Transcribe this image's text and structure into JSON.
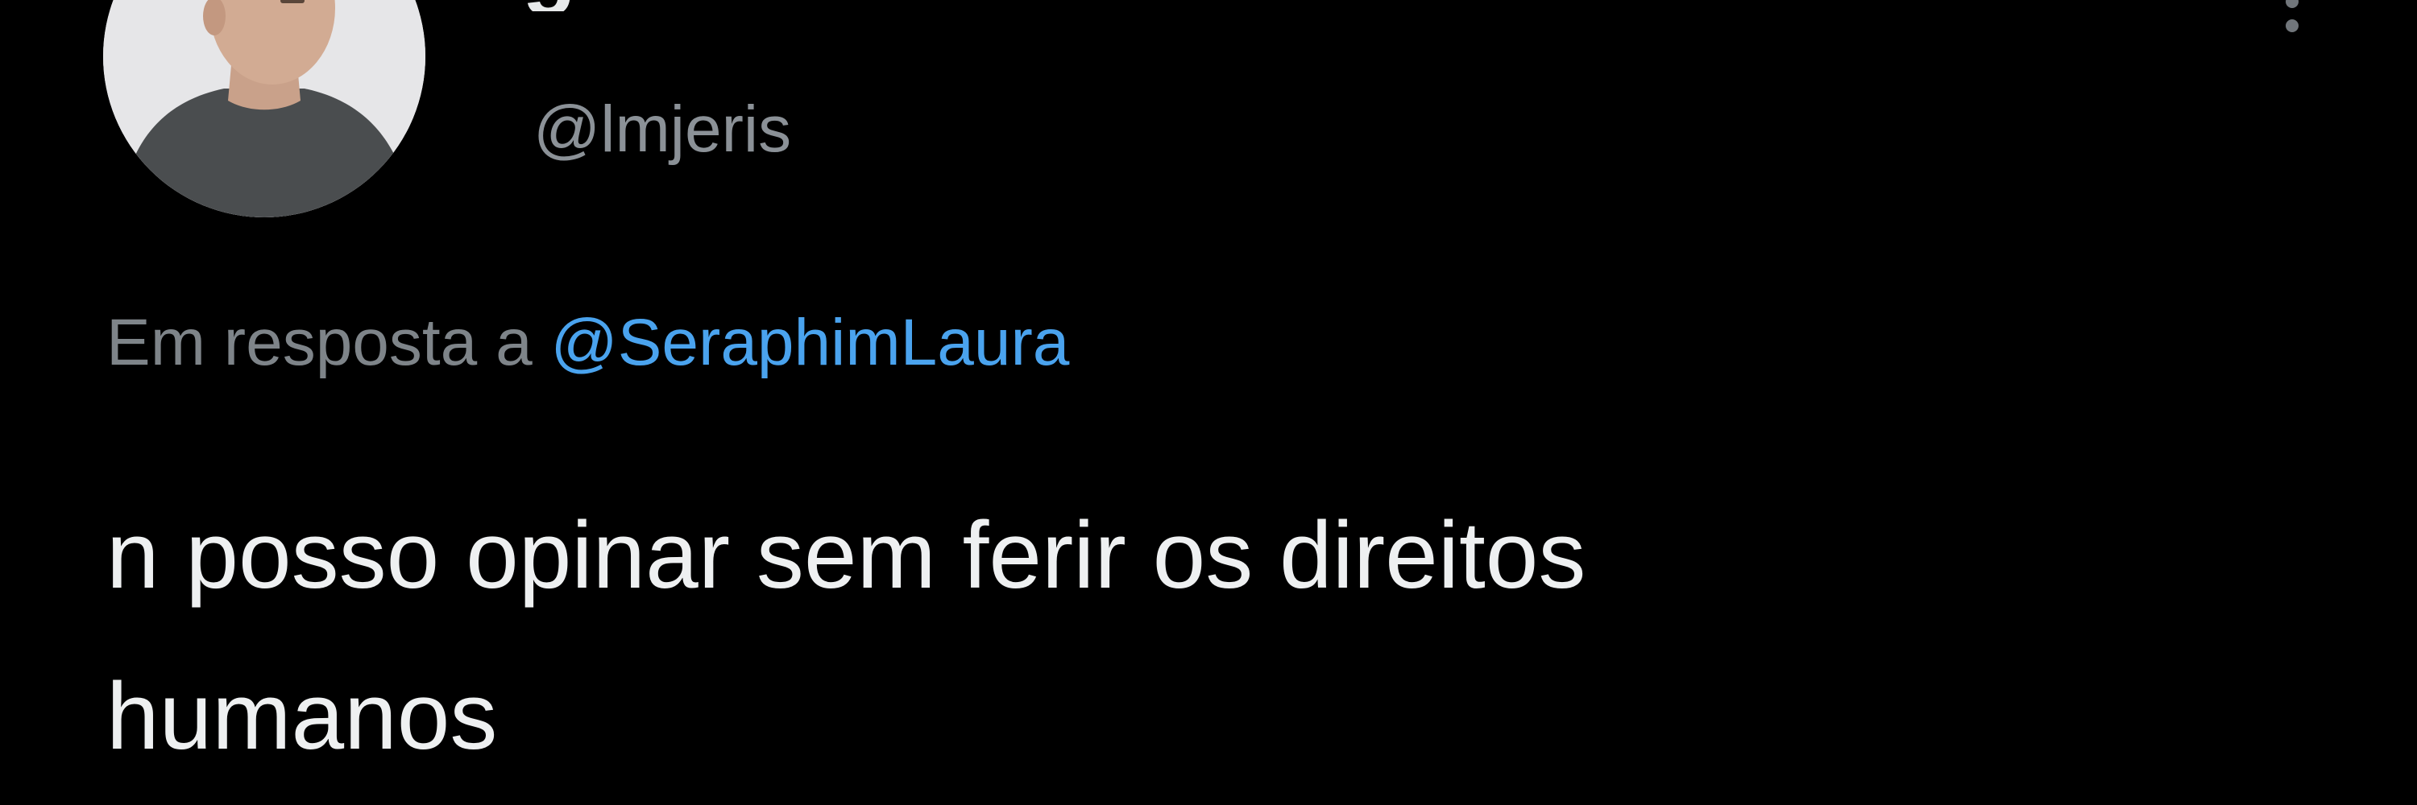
{
  "tweet": {
    "display_name_partial": "g",
    "handle": "@lmjeris",
    "reply_prefix": "Em resposta a",
    "reply_mention": "@SeraphimLaura",
    "text": "n posso opinar sem ferir os direitos\nhumanos",
    "more_icon": "more-vertical-icon"
  },
  "colors": {
    "background": "#000000",
    "text_primary": "#eef0f1",
    "text_secondary": "#7e8489",
    "mention_link": "#4aa3ee"
  }
}
